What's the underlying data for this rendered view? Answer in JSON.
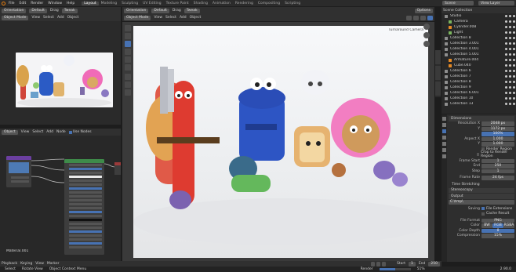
{
  "topbar": {
    "menus": [
      "File",
      "Edit",
      "Render",
      "Window",
      "Help"
    ],
    "workspaces": [
      "Layout",
      "Modeling",
      "Sculpting",
      "UV Editing",
      "Texture Paint",
      "Shading",
      "Animation",
      "Rendering",
      "Compositing",
      "Scripting"
    ],
    "active_workspace": "Layout",
    "scene_label": "Scene",
    "view_layer_label": "View Layer"
  },
  "left_top": {
    "header": {
      "mode": "Orientation",
      "default": "Default",
      "drag": "Drag",
      "tweak": "Tweak"
    },
    "subheader": {
      "mode": "Object Mode",
      "view": "View",
      "select": "Select",
      "add": "Add",
      "object": "Object"
    }
  },
  "viewport": {
    "header": {
      "mode": "Object Mode",
      "view": "View",
      "select": "Select",
      "add": "Add",
      "object": "Object",
      "orientation": "Orientation",
      "default": "Default",
      "drag": "Drag",
      "tweak": "Tweak",
      "options": "Options"
    },
    "camera_label": "Turnaround Camera"
  },
  "node_editor": {
    "header": {
      "type": "Object",
      "view": "View",
      "select": "Select",
      "add": "Add",
      "node": "Node",
      "use_nodes": "Use Nodes"
    },
    "material_label": "Material.001"
  },
  "outliner": {
    "title": "Scene Collection",
    "items": [
      {
        "label": "Studio",
        "icon": "collection"
      },
      {
        "label": "Camera",
        "icon": "camera"
      },
      {
        "label": "Cylinder.008",
        "icon": "mesh"
      },
      {
        "label": "Light",
        "icon": "light"
      },
      {
        "label": "Collection 8",
        "icon": "collection"
      },
      {
        "label": "Collection 3.001",
        "icon": "collection"
      },
      {
        "label": "Collection 4.001",
        "icon": "collection"
      },
      {
        "label": "Collection 5.001",
        "icon": "collection"
      },
      {
        "label": "Armature.004",
        "icon": "armature"
      },
      {
        "label": "Cube.040",
        "icon": "mesh"
      },
      {
        "label": "Collection 6",
        "icon": "collection"
      },
      {
        "label": "Collection 7",
        "icon": "collection"
      },
      {
        "label": "Collection 8",
        "icon": "collection"
      },
      {
        "label": "Collection 9",
        "icon": "collection"
      },
      {
        "label": "Collection 6.001",
        "icon": "collection"
      },
      {
        "label": "Collection 10",
        "icon": "collection"
      },
      {
        "label": "Collection 13",
        "icon": "collection"
      }
    ]
  },
  "properties": {
    "section": "Dimensions",
    "resolution_x_label": "Resolution X",
    "resolution_x": "2048 px",
    "y_label": "Y",
    "resolution_y": "1172 px",
    "pct": "100%",
    "aspect_x_label": "Aspect X",
    "aspect_x": "1.000",
    "aspect_y": "1.000",
    "render_region": "Render Region",
    "crop_region": "Crop to Render Region",
    "frame_start_label": "Frame Start",
    "frame_start": "1",
    "end_label": "End",
    "frame_end": "250",
    "step_label": "Step",
    "step": "1",
    "frame_rate_label": "Frame Rate",
    "frame_rate": "24 fps",
    "time_stretching": "Time Stretching",
    "stereoscopy": "Stereoscopy",
    "output": "Output",
    "output_path": "C:\\tmp\\",
    "saving_label": "Saving",
    "file_extensions": "File Extensions",
    "cache_result": "Cache Result",
    "file_format_label": "File Format",
    "file_format": "PNG",
    "color_label": "Color",
    "color_options": [
      "BW",
      "RGB",
      "RGBA"
    ],
    "color_depth_label": "Color Depth",
    "color_depth": "8",
    "compression_label": "Compression",
    "compression": "15%"
  },
  "timeline": {
    "playback": "Playback",
    "keying": "Keying",
    "view": "View",
    "marker": "Marker",
    "start_label": "Start",
    "start": "1",
    "end_label": "End",
    "end": "250"
  },
  "statusbar": {
    "left": "Select",
    "mid": "Rotate View",
    "right": "Object Context Menu",
    "render_label": "Render",
    "render_pct": "51%",
    "version": "2.90.0"
  },
  "colors": {
    "accent": "#4772b3",
    "brand": "#e87d0d"
  }
}
